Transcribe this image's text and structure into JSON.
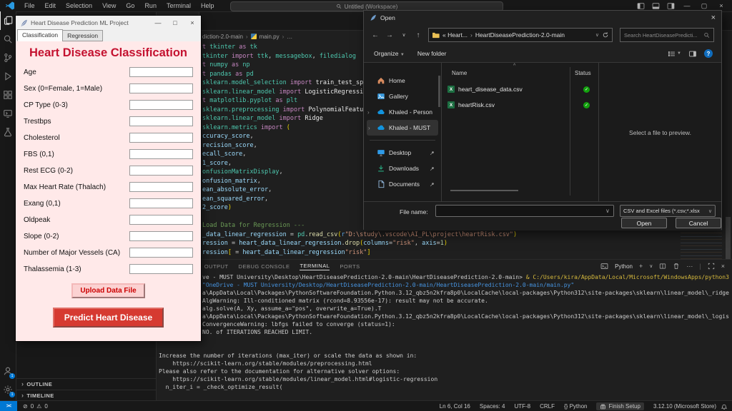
{
  "app": {
    "search_placeholder": "Untitled (Workspace)"
  },
  "titlebar": {
    "menus": [
      "File",
      "Edit",
      "Selection",
      "View",
      "Go",
      "Run",
      "Terminal",
      "Help"
    ]
  },
  "activity_bar": {
    "icons": [
      "explorer",
      "search",
      "source-control",
      "run-and-debug",
      "extensions",
      "remote-explorer",
      "testing"
    ],
    "account_badge": "1",
    "settings_badge": "1"
  },
  "sidebar": {
    "sections": [
      "OUTLINE",
      "TIMELINE"
    ]
  },
  "editor": {
    "breadcrumb": [
      "diction-2.0-main",
      "main.py",
      "…"
    ],
    "code_lines": [
      [
        {
          "c": "k",
          "t": "t "
        },
        {
          "c": "m",
          "t": "tkinter"
        },
        {
          "c": "k",
          "t": " as "
        },
        {
          "c": "m",
          "t": "tk"
        }
      ],
      [
        {
          "c": "m",
          "t": "tkinter"
        },
        {
          "c": "k",
          "t": " import "
        },
        {
          "c": "m",
          "t": "ttk"
        },
        {
          "c": "p",
          "t": ", "
        },
        {
          "c": "m",
          "t": "messagebox"
        },
        {
          "c": "p",
          "t": ", "
        },
        {
          "c": "m",
          "t": "filedialog"
        }
      ],
      [
        {
          "c": "k",
          "t": "t "
        },
        {
          "c": "m",
          "t": "numpy"
        },
        {
          "c": "k",
          "t": " as "
        },
        {
          "c": "m",
          "t": "np"
        }
      ],
      [
        {
          "c": "k",
          "t": "t "
        },
        {
          "c": "m",
          "t": "pandas"
        },
        {
          "c": "k",
          "t": " as "
        },
        {
          "c": "m",
          "t": "pd"
        }
      ],
      [
        {
          "c": "m",
          "t": "sklearn.model_selection"
        },
        {
          "c": "k",
          "t": " import "
        },
        {
          "c": "w",
          "t": "train_test_split"
        }
      ],
      [
        {
          "c": "m",
          "t": "sklearn.linear_model"
        },
        {
          "c": "k",
          "t": " import "
        },
        {
          "c": "w",
          "t": "LogisticRegression"
        }
      ],
      [
        {
          "c": "k",
          "t": "t "
        },
        {
          "c": "m",
          "t": "matplotlib.pyplot"
        },
        {
          "c": "k",
          "t": " as "
        },
        {
          "c": "m",
          "t": "plt"
        }
      ],
      [
        {
          "c": "m",
          "t": "sklearn.preprocessing"
        },
        {
          "c": "k",
          "t": " import "
        },
        {
          "c": "w",
          "t": "PolynomialFeatures"
        }
      ],
      [
        {
          "c": "m",
          "t": "sklearn.linear_model"
        },
        {
          "c": "k",
          "t": " import "
        },
        {
          "c": "w",
          "t": "Ridge"
        }
      ],
      [
        {
          "c": "m",
          "t": "sklearn.metrics"
        },
        {
          "c": "k",
          "t": " import "
        },
        {
          "c": "y",
          "t": "("
        }
      ],
      [
        {
          "c": "v",
          "t": "ccuracy_score"
        },
        {
          "c": "p",
          "t": ","
        }
      ],
      [
        {
          "c": "v",
          "t": "recision_score"
        },
        {
          "c": "p",
          "t": ","
        }
      ],
      [
        {
          "c": "v",
          "t": "ecall_score"
        },
        {
          "c": "p",
          "t": ","
        }
      ],
      [
        {
          "c": "v",
          "t": "1_score"
        },
        {
          "c": "p",
          "t": ","
        }
      ],
      [
        {
          "c": "m",
          "t": "onfusionMatrixDisplay"
        },
        {
          "c": "p",
          "t": ","
        }
      ],
      [
        {
          "c": "v",
          "t": "onfusion_matrix"
        },
        {
          "c": "p",
          "t": ","
        }
      ],
      [
        {
          "c": "v",
          "t": "ean_absolute_error"
        },
        {
          "c": "p",
          "t": ","
        }
      ],
      [
        {
          "c": "v",
          "t": "ean_squared_error"
        },
        {
          "c": "p",
          "t": ","
        }
      ],
      [
        {
          "c": "v",
          "t": "2_score"
        },
        {
          "c": "y",
          "t": ")"
        }
      ],
      [],
      [
        {
          "c": "c",
          "t": "Load Data for Regression ---"
        }
      ],
      [
        {
          "c": "v",
          "t": "_data_linear_regression"
        },
        {
          "c": "p",
          "t": " = "
        },
        {
          "c": "m",
          "t": "pd"
        },
        {
          "c": "p",
          "t": "."
        },
        {
          "c": "f",
          "t": "read_csv"
        },
        {
          "c": "y",
          "t": "("
        },
        {
          "c": "b",
          "t": "r"
        },
        {
          "c": "s",
          "t": "\"D:\\study\\.vscode\\AI_PL\\project\\heartRisk.csv\""
        },
        {
          "c": "y",
          "t": ")"
        }
      ],
      [
        {
          "c": "v",
          "t": "ression"
        },
        {
          "c": "p",
          "t": " = "
        },
        {
          "c": "v",
          "t": "heart_data_linear_regression"
        },
        {
          "c": "p",
          "t": "."
        },
        {
          "c": "f",
          "t": "drop"
        },
        {
          "c": "y",
          "t": "("
        },
        {
          "c": "v",
          "t": "columns"
        },
        {
          "c": "p",
          "t": "="
        },
        {
          "c": "s",
          "t": "\"risk\""
        },
        {
          "c": "p",
          "t": ", "
        },
        {
          "c": "v",
          "t": "axis"
        },
        {
          "c": "p",
          "t": "="
        },
        {
          "c": "n",
          "t": "1"
        },
        {
          "c": "y",
          "t": ")"
        }
      ],
      [
        {
          "c": "v",
          "t": "ression"
        },
        {
          "c": "y",
          "t": "["
        },
        {
          "c": "p",
          "t": " = "
        },
        {
          "c": "v",
          "t": "heart_data_linear_regression"
        },
        {
          "c": "s",
          "t": "\"risk\""
        },
        {
          "c": "y",
          "t": "]"
        }
      ]
    ]
  },
  "terminal": {
    "tabs": [
      "PROBLEMS",
      "OUTPUT",
      "DEBUG CONSOLE",
      "TERMINAL",
      "PORTS"
    ],
    "active_tab": "TERMINAL",
    "shell": "Python",
    "lines": [
      {
        "pad": true,
        "seg": [
          {
            "c": "t",
            "t": "ve - MUST University\\Desktop\\HeartDiseasePrediction-2.0-main\\HeartDiseasePrediction-2.0-main> "
          },
          {
            "c": "ty",
            "t": "& C:/Users/kira/AppData/Local/Microsoft/WindowsApps/python3"
          }
        ]
      },
      {
        "pad": true,
        "seg": [
          {
            "c": "tb",
            "t": "\"OneDrive - MUST University/Desktop/HeartDiseasePrediction-2.0-main/HeartDiseasePrediction-2.0-main/main.py\""
          }
        ]
      },
      {
        "pad": true,
        "seg": [
          {
            "c": "t",
            "t": "a\\AppData\\Local\\Packages\\PythonSoftwareFoundation.Python.3.12_qbz5n2kfra8p0\\LocalCache\\local-packages\\Python312\\site-packages\\sklearn\\linear_model\\_ridge"
          }
        ]
      },
      {
        "pad": true,
        "seg": [
          {
            "c": "t",
            "t": "AlgWarning: Ill-conditioned matrix (rcond=8.93556e-17): result may not be accurate."
          }
        ]
      },
      {
        "pad": true,
        "seg": [
          {
            "c": "t",
            "t": "alg.solve(A, Xy, assume_a=\"pos\", overwrite_a=True).T"
          }
        ]
      },
      {
        "pad": true,
        "seg": [
          {
            "c": "t",
            "t": "a\\AppData\\Local\\Packages\\PythonSoftwareFoundation.Python.3.12_qbz5n2kfra8p0\\LocalCache\\local-packages\\Python312\\site-packages\\sklearn\\linear_model\\_logis"
          }
        ]
      },
      {
        "pad": true,
        "seg": [
          {
            "c": "t",
            "t": "ConvergenceWarning: lbfgs failed to converge (status=1):"
          }
        ]
      },
      {
        "pad": true,
        "seg": [
          {
            "c": "t",
            "t": "NO. of ITERATIONS REACHED LIMIT."
          }
        ]
      },
      {
        "pad": false,
        "seg": []
      },
      {
        "pad": false,
        "seg": []
      },
      {
        "pad": false,
        "seg": [
          {
            "c": "t",
            "t": "Increase the number of iterations (max_iter) or scale the data as shown in:"
          }
        ]
      },
      {
        "pad": false,
        "seg": [
          {
            "c": "t",
            "t": "    https://scikit-learn.org/stable/modules/preprocessing.html"
          }
        ]
      },
      {
        "pad": false,
        "seg": [
          {
            "c": "t",
            "t": "Please also refer to the documentation for alternative solver options:"
          }
        ]
      },
      {
        "pad": false,
        "seg": [
          {
            "c": "t",
            "t": "    https://scikit-learn.org/stable/modules/linear_model.html#logistic-regression"
          }
        ]
      },
      {
        "pad": false,
        "seg": [
          {
            "c": "t",
            "t": "  n_iter_i = _check_optimize_result("
          }
        ]
      }
    ]
  },
  "status_bar": {
    "errors": "0",
    "warnings": "0",
    "right": [
      {
        "label": "Ln 6, Col 16"
      },
      {
        "label": "Spaces: 4"
      },
      {
        "label": "UTF-8"
      },
      {
        "label": "CRLF"
      },
      {
        "label": "{} Python"
      },
      {
        "label": "Finish Setup",
        "pill": true,
        "icon": "gift"
      },
      {
        "label": "3.12.10 (Microsoft Store)"
      }
    ]
  },
  "tk_window": {
    "title": "Heart Disease Prediction ML Project",
    "tabs": [
      "Classification",
      "Regression"
    ],
    "heading": "Heart Disease Classification",
    "heading_color": "#c41230",
    "fields": [
      "Age",
      "Sex (0=Female, 1=Male)",
      "CP Type (0-3)",
      "Trestbps",
      "Cholesterol",
      "FBS (0,1)",
      "Rest ECG (0-2)",
      "Max Heart Rate (Thalach)",
      "Exang (0,1)",
      "Oldpeak",
      "Slope (0-2)",
      "Number of Major Vessels (CA)",
      "Thalassemia (1-3)"
    ],
    "upload_label": "Upload Data File",
    "predict_label": "Predict Heart Disease",
    "predict_color": "#d63a31"
  },
  "open_dialog": {
    "title": "Open",
    "address": {
      "crumbs": [
        "« Heart...",
        "HeartDiseasePrediction-2.0-main"
      ]
    },
    "search_placeholder": "Search HeartDiseasePredicti...",
    "toolbar": {
      "organize": "Organize",
      "new_folder": "New folder"
    },
    "nav_sidebar": [
      {
        "label": "Home",
        "icon": "home"
      },
      {
        "label": "Gallery",
        "icon": "gallery"
      },
      {
        "label": "Khaled - Person",
        "icon": "cloud",
        "chevron": true
      },
      {
        "label": "Khaled - MUST",
        "icon": "cloud",
        "chevron": true,
        "selected": true
      },
      {
        "label": "Desktop",
        "icon": "desktop",
        "pin": true,
        "divider_before": true
      },
      {
        "label": "Downloads",
        "icon": "downloads",
        "pin": true
      },
      {
        "label": "Documents",
        "icon": "documents",
        "pin": true
      }
    ],
    "columns": [
      "Name",
      "Status"
    ],
    "files": [
      {
        "name": "heart_disease_data.csv",
        "status": "synced"
      },
      {
        "name": "heartRisk.csv",
        "status": "synced"
      }
    ],
    "preview_hint": "Select a file to preview.",
    "file_name_label": "File name:",
    "file_name_value": "",
    "file_type_filter": "CSV and Excel files (*.csv;*.xlsx",
    "open_label": "Open",
    "cancel_label": "Cancel"
  }
}
